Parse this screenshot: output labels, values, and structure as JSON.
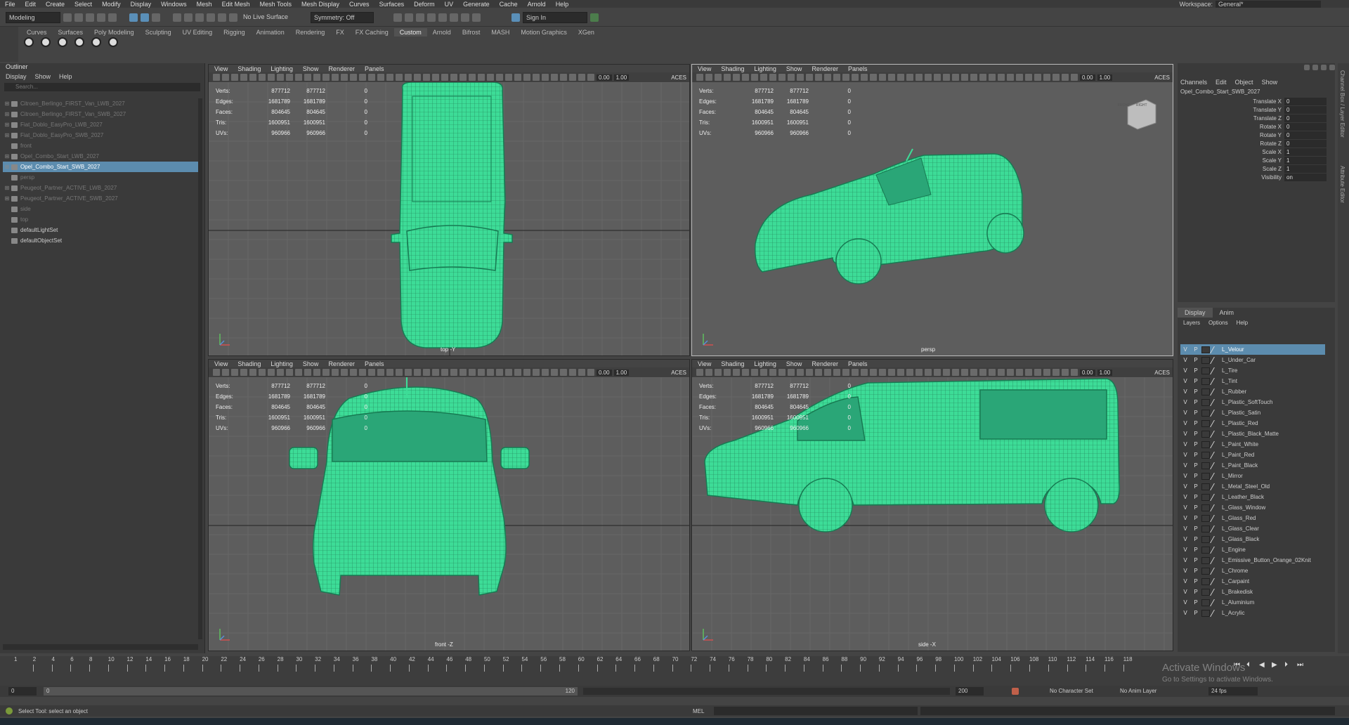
{
  "menubar": {
    "items": [
      "File",
      "Edit",
      "Create",
      "Select",
      "Modify",
      "Display",
      "Windows",
      "Mesh",
      "Edit Mesh",
      "Mesh Tools",
      "Mesh Display",
      "Curves",
      "Surfaces",
      "Deform",
      "UV",
      "Generate",
      "Cache",
      "Arnold",
      "Help"
    ],
    "workspace_label": "Workspace:",
    "workspace_value": "General*"
  },
  "statusline": {
    "mode": "Modeling",
    "live_surface": "No Live Surface",
    "symmetry": "Symmetry: Off",
    "signin": "Sign In"
  },
  "shelf": {
    "tabs": [
      "Curves",
      "Surfaces",
      "Poly Modeling",
      "Sculpting",
      "UV Editing",
      "Rigging",
      "Animation",
      "Rendering",
      "FX",
      "FX Caching",
      "Custom",
      "Arnold",
      "Bifrost",
      "MASH",
      "Motion Graphics",
      "XGen"
    ],
    "active_tab": "Custom"
  },
  "outliner": {
    "title": "Outliner",
    "menus": [
      "Display",
      "Show",
      "Help"
    ],
    "search_placeholder": "Search...",
    "items": [
      {
        "label": "Citroen_Berlingo_FIRST_Van_LWB_2027",
        "dim": true,
        "exp": "⊞"
      },
      {
        "label": "Citroen_Berlingo_FIRST_Van_SWB_2027",
        "dim": true,
        "exp": "⊞"
      },
      {
        "label": "Fiat_Doblo_EasyPro_LWB_2027",
        "dim": true,
        "exp": "⊞"
      },
      {
        "label": "Fiat_Doblo_EasyPro_SWB_2027",
        "dim": true,
        "exp": "⊞"
      },
      {
        "label": "front",
        "dim": true,
        "exp": ""
      },
      {
        "label": "Opel_Combo_Start_LWB_2027",
        "dim": true,
        "exp": "⊞"
      },
      {
        "label": "Opel_Combo_Start_SWB_2027",
        "dim": false,
        "exp": "⊞",
        "sel": true
      },
      {
        "label": "persp",
        "dim": true,
        "exp": ""
      },
      {
        "label": "Peugeot_Partner_ACTIVE_LWB_2027",
        "dim": true,
        "exp": "⊞"
      },
      {
        "label": "Peugeot_Partner_ACTIVE_SWB_2027",
        "dim": true,
        "exp": "⊞"
      },
      {
        "label": "side",
        "dim": true,
        "exp": ""
      },
      {
        "label": "top",
        "dim": true,
        "exp": ""
      },
      {
        "label": "defaultLightSet",
        "dim": false,
        "exp": ""
      },
      {
        "label": "defaultObjectSet",
        "dim": false,
        "exp": ""
      }
    ]
  },
  "viewport": {
    "menus": [
      "View",
      "Shading",
      "Lighting",
      "Show",
      "Renderer",
      "Panels"
    ],
    "num1": "0.00",
    "num2": "1.00",
    "aces": "ACES",
    "hud": [
      {
        "label": "Verts:",
        "v1": "877712",
        "v2": "877712",
        "v3": "0"
      },
      {
        "label": "Edges:",
        "v1": "1681789",
        "v2": "1681789",
        "v3": "0"
      },
      {
        "label": "Faces:",
        "v1": "804645",
        "v2": "804645",
        "v3": "0"
      },
      {
        "label": "Tris:",
        "v1": "1600951",
        "v2": "1600951",
        "v3": "0"
      },
      {
        "label": "UVs:",
        "v1": "960966",
        "v2": "960966",
        "v3": "0"
      }
    ],
    "labels": {
      "top": "top -Y",
      "persp": "persp",
      "front": "front -Z",
      "side": "side -X"
    },
    "cube_front": "FRONT",
    "cube_right": "RIGHT",
    "wire_color": "#3ddc97"
  },
  "channelbox": {
    "menus": [
      "Channels",
      "Edit",
      "Object",
      "Show"
    ],
    "object": "Opel_Combo_Start_SWB_2027",
    "attrs": [
      {
        "label": "Translate X",
        "value": "0"
      },
      {
        "label": "Translate Y",
        "value": "0"
      },
      {
        "label": "Translate Z",
        "value": "0"
      },
      {
        "label": "Rotate X",
        "value": "0"
      },
      {
        "label": "Rotate Y",
        "value": "0"
      },
      {
        "label": "Rotate Z",
        "value": "0"
      },
      {
        "label": "Scale X",
        "value": "1"
      },
      {
        "label": "Scale Y",
        "value": "1"
      },
      {
        "label": "Scale Z",
        "value": "1"
      },
      {
        "label": "Visibility",
        "value": "on"
      }
    ],
    "side_tab1": "Channel Box / Layer Editor",
    "side_tab2": "Attribute Editor"
  },
  "layers": {
    "tabs": [
      "Display",
      "Anim"
    ],
    "menus": [
      "Layers",
      "Options",
      "Help"
    ],
    "v": "V",
    "p": "P",
    "items": [
      "L_Velour",
      "L_Under_Car",
      "L_Tire",
      "L_Tint",
      "L_Rubber",
      "L_Plastic_SoftTouch",
      "L_Plastic_Satin",
      "L_Plastic_Red",
      "L_Plastic_Black_Matte",
      "L_Paint_White",
      "L_Paint_Red",
      "L_Paint_Black",
      "L_Mirror",
      "L_Metal_Steel_Old",
      "L_Leather_Black",
      "L_Glass_Window",
      "L_Glass_Red",
      "L_Glass_Clear",
      "L_Glass_Black",
      "L_Engine",
      "L_Emissive_Button_Orange_02Knit",
      "L_Chrome",
      "L_Carpaint",
      "L_Brakedisk",
      "L_Aluminium",
      "L_Acrylic"
    ]
  },
  "timeline": {
    "ticks": [
      "2",
      "4",
      "6",
      "8",
      "10",
      "12",
      "14",
      "16",
      "18",
      "20",
      "22",
      "24",
      "26",
      "28",
      "30",
      "32",
      "34",
      "36",
      "38",
      "40",
      "42",
      "44",
      "46",
      "48",
      "50",
      "52",
      "54",
      "56",
      "58",
      "60",
      "62",
      "64",
      "66",
      "68",
      "70",
      "72",
      "74",
      "76",
      "78",
      "80",
      "82",
      "84",
      "86",
      "88",
      "90",
      "92",
      "94",
      "96",
      "98",
      "100",
      "102",
      "104",
      "106",
      "108",
      "110",
      "112",
      "114",
      "116",
      "118"
    ],
    "current": "1",
    "range_start": "0",
    "range_inner_start": "0",
    "range_inner_end": "120",
    "range_end": "200",
    "character_set": "No Character Set",
    "anim_layer": "No Anim Layer",
    "fps": "24 fps"
  },
  "commandline": {
    "help": "Select Tool: select an object",
    "mel": "MEL"
  },
  "watermark": {
    "line1": "Activate Windows",
    "line2": "Go to Settings to activate Windows."
  }
}
